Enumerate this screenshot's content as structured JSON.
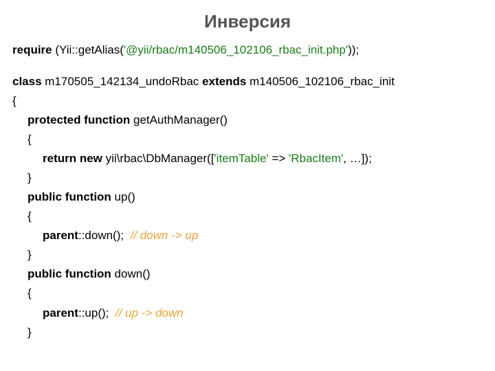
{
  "title": "Инверсия",
  "line1": {
    "kw1": "require",
    "t1": " (Yii::getAlias(",
    "str": "'@yii/rbac/m140506_102106_rbac_init.php'",
    "t2": "));"
  },
  "line2": {
    "kw1": "class",
    "t1": " m170505_142134_undoRbac ",
    "kw2": "extends",
    "t2": " m140506_102106_rbac_init"
  },
  "brace_open": "{",
  "brace_close": "}",
  "getAuth": {
    "kw": "protected function",
    "name": " getAuthManager()"
  },
  "ret": {
    "kw": "return new",
    "t1": " yii\\rbac\\DbManager([",
    "s1": "'itemTable'",
    "t2": " => ",
    "s2": "'RbacItem'",
    "t3": ", …]);"
  },
  "up": {
    "kw": "public function",
    "name": " up()"
  },
  "upbody": {
    "kw": "parent",
    "t": "::down();  ",
    "comment": "// down -> up"
  },
  "down": {
    "kw": "public function",
    "name": " down()"
  },
  "downbody": {
    "kw": "parent",
    "t": "::up();  ",
    "comment": "// up -> down"
  }
}
